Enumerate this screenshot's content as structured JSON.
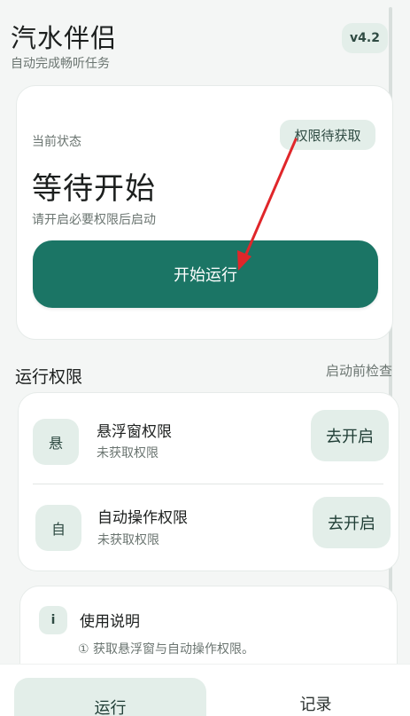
{
  "header": {
    "title": "汽水伴侣",
    "subtitle": "自动完成畅听任务",
    "version": "v4.2"
  },
  "status_card": {
    "label": "当前状态",
    "badge": "权限待获取",
    "value": "等待开始",
    "hint": "请开启必要权限后启动",
    "start_button": "开始运行"
  },
  "permissions": {
    "section_title": "运行权限",
    "section_action": "启动前检查",
    "items": [
      {
        "icon_char": "悬",
        "title": "悬浮窗权限",
        "status": "未获取权限",
        "button": "去开启"
      },
      {
        "icon_char": "自",
        "title": "自动操作权限",
        "status": "未获取权限",
        "button": "去开启"
      }
    ]
  },
  "usage": {
    "icon_char": "i",
    "title": "使用说明",
    "step_1": "① 获取悬浮窗与自动操作权限。"
  },
  "bottom_nav": {
    "tabs": [
      {
        "label": "运行",
        "active": true
      },
      {
        "label": "记录",
        "active": false
      }
    ]
  },
  "colors": {
    "primary": "#1b7565",
    "chip_bg": "#e3eee9",
    "annotation_arrow": "#e0262a"
  }
}
